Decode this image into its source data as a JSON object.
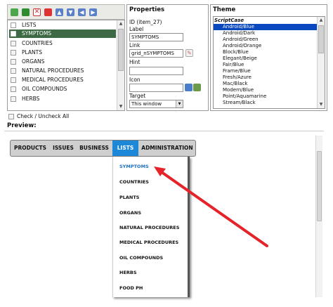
{
  "tree": {
    "items": [
      {
        "label": "LISTS"
      },
      {
        "label": "SYMPTOMS"
      },
      {
        "label": "COUNTRIES"
      },
      {
        "label": "PLANTS"
      },
      {
        "label": "ORGANS"
      },
      {
        "label": "NATURAL PROCEDURES"
      },
      {
        "label": "MEDICAL PROCEDURES"
      },
      {
        "label": "OIL COMPOUNDS"
      },
      {
        "label": "HERBS"
      }
    ],
    "selected_index": 1
  },
  "properties": {
    "title": "Properties",
    "id_label": "ID (item_27)",
    "label_label": "Label",
    "label_value": "SYMPTOMS",
    "link_label": "Link",
    "link_value": "grid_nSYMPTOMS",
    "hint_label": "Hint",
    "hint_value": "",
    "icon_label": "Icon",
    "icon_value": "",
    "target_label": "Target",
    "target_value": "This window"
  },
  "theme": {
    "title": "Theme",
    "group": "ScriptCase",
    "options": [
      "Android/Blue",
      "Android/Dark",
      "Android/Green",
      "Android/Orange",
      "Block/Blue",
      "Elegant/Beige",
      "Fair/Blue",
      "Frame/Blue",
      "Fresh/Azure",
      "Mac/Black",
      "Modern/Blue",
      "Point/Aquamarine",
      "Stream/Black"
    ],
    "selected_index": 0
  },
  "check_all_label": "Check / Uncheck All",
  "preview_label": "Preview:",
  "menu": {
    "items": [
      "PRODUCTS",
      "ISSUES",
      "BUSINESS",
      "LISTS",
      "ADMINISTRATION"
    ],
    "active_index": 3,
    "active_color": "#1d88d8"
  },
  "dropdown": {
    "items": [
      "SYMPTOMS",
      "COUNTRIES",
      "PLANTS",
      "ORGANS",
      "NATURAL PROCEDURES",
      "MEDICAL PROCEDURES",
      "OIL COMPOUNDS",
      "HERBS",
      "FOOD PH"
    ]
  },
  "colors": {
    "annotation_arrow": "#e5242a",
    "tree_selection": "#3d6a44",
    "theme_selection": "#0a48c0"
  },
  "toolbar_icons": [
    "add-item-icon",
    "add-subitem-icon",
    "delete-icon",
    "delete-all-icon",
    "move-up-icon",
    "move-down-icon",
    "move-left-icon",
    "move-right-icon"
  ]
}
